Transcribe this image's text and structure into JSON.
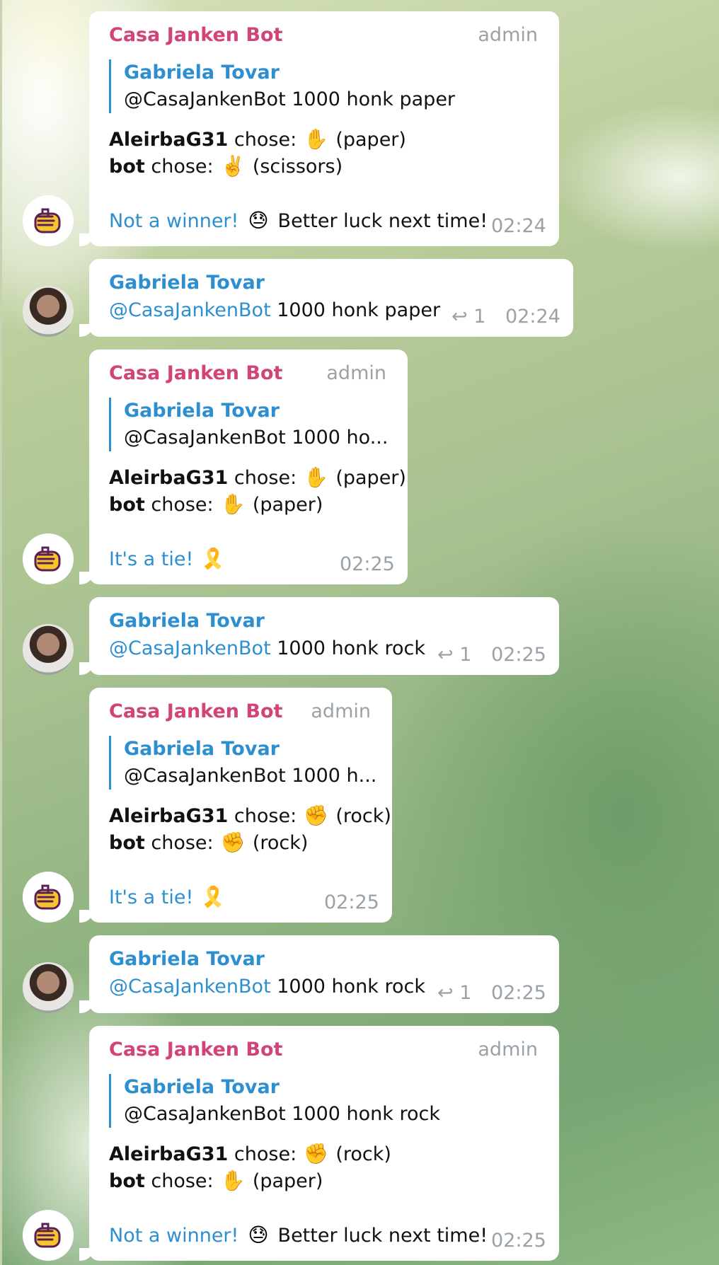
{
  "theme": {
    "bot_name_color": "#d0447a",
    "user_name_color": "#2d8fd0",
    "link_color": "#2d8fd0",
    "meta_color": "#9aa2a9",
    "bubble_color": "#ffffff"
  },
  "icons": {
    "bot_avatar": "fist-hand-icon",
    "reply": "reply-arrow-icon",
    "paper": "raised-hand-icon",
    "scissors": "victory-hand-icon",
    "rock": "raised-fist-icon",
    "lose": "downcast-sweat-face-icon",
    "tie": "yellow-ribbon-icon"
  },
  "messages": [
    {
      "sender": "Casa Janken Bot",
      "role": "admin",
      "quote": {
        "name": "Gabriela Tovar",
        "text": "@CasaJankenBot  1000 honk paper"
      },
      "player": "AleirbaG31",
      "chose_label": " chose: ",
      "player_emoji": "✋",
      "player_choice": "(paper)",
      "bot": "bot",
      "bot_emoji": "✌️",
      "bot_choice": "(scissors)",
      "result_link": "Not a winner!",
      "result_emoji": "😓",
      "result_text": "Better luck next time!",
      "time": "02:24"
    },
    {
      "sender": "Gabriela Tovar",
      "mention": "@CasaJankenBot",
      "text": "1000 honk paper",
      "replies": "1",
      "time": "02:24"
    },
    {
      "sender": "Casa Janken Bot",
      "role": "admin",
      "quote": {
        "name": "Gabriela Tovar",
        "text": "@CasaJankenBot  1000 ho..."
      },
      "player": "AleirbaG31",
      "chose_label": " chose: ",
      "player_emoji": "✋",
      "player_choice": "(paper)",
      "bot": "bot",
      "bot_emoji": "✋",
      "bot_choice": "(paper)",
      "result_link": "It's a tie!",
      "result_emoji": "🎗️",
      "result_text": "",
      "time": "02:25"
    },
    {
      "sender": "Gabriela Tovar",
      "mention": "@CasaJankenBot",
      "text": "1000 honk rock",
      "replies": "1",
      "time": "02:25"
    },
    {
      "sender": "Casa Janken Bot",
      "role": "admin",
      "quote": {
        "name": "Gabriela Tovar",
        "text": "@CasaJankenBot  1000 h..."
      },
      "player": "AleirbaG31",
      "chose_label": " chose: ",
      "player_emoji": "✊",
      "player_choice": "(rock)",
      "bot": "bot",
      "bot_emoji": "✊",
      "bot_choice": "(rock)",
      "result_link": "It's a tie!",
      "result_emoji": "🎗️",
      "result_text": "",
      "time": "02:25"
    },
    {
      "sender": "Gabriela Tovar",
      "mention": "@CasaJankenBot",
      "text": "1000 honk rock",
      "replies": "1",
      "time": "02:25"
    },
    {
      "sender": "Casa Janken Bot",
      "role": "admin",
      "quote": {
        "name": "Gabriela Tovar",
        "text": "@CasaJankenBot  1000 honk rock"
      },
      "player": "AleirbaG31",
      "chose_label": " chose: ",
      "player_emoji": "✊",
      "player_choice": "(rock)",
      "bot": "bot",
      "bot_emoji": "✋",
      "bot_choice": "(paper)",
      "result_link": "Not a winner!",
      "result_emoji": "😓",
      "result_text": "Better luck next time!",
      "time": "02:25"
    }
  ]
}
